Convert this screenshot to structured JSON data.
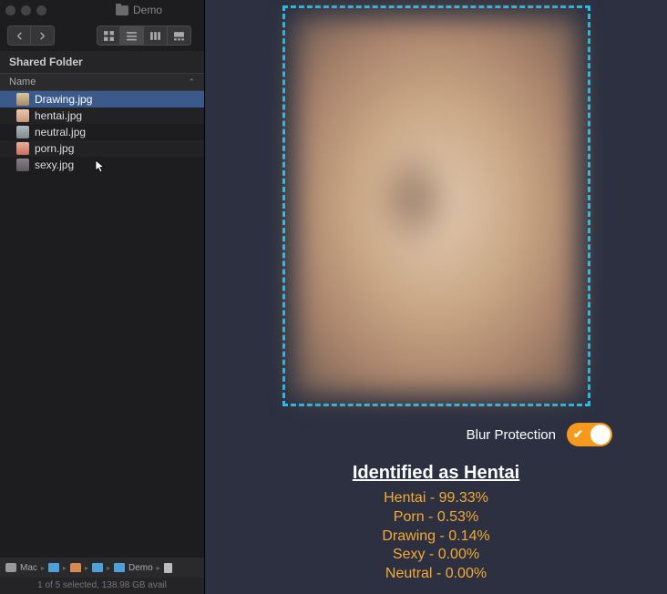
{
  "window": {
    "folder_name": "Demo"
  },
  "sidebar": {
    "section_title": "Shared Folder",
    "column_header": "Name",
    "files": [
      {
        "name": "Drawing.jpg",
        "selected": true
      },
      {
        "name": "hentai.jpg",
        "selected": false
      },
      {
        "name": "neutral.jpg",
        "selected": false
      },
      {
        "name": "porn.jpg",
        "selected": false
      },
      {
        "name": "sexy.jpg",
        "selected": false
      }
    ],
    "pathbar": {
      "mac": "Mac",
      "demo": "Demo"
    },
    "status": "1 of 5 selected, 138.98 GB avail"
  },
  "main": {
    "blur_label": "Blur Protection",
    "toggle_on": true,
    "result_title": "Identified as Hentai",
    "results": [
      {
        "label": "Hentai",
        "pct": "99.33%"
      },
      {
        "label": "Porn",
        "pct": "0.53%"
      },
      {
        "label": "Drawing",
        "pct": "0.14%"
      },
      {
        "label": "Sexy",
        "pct": "0.00%"
      },
      {
        "label": "Neutral",
        "pct": "0.00%"
      }
    ]
  }
}
